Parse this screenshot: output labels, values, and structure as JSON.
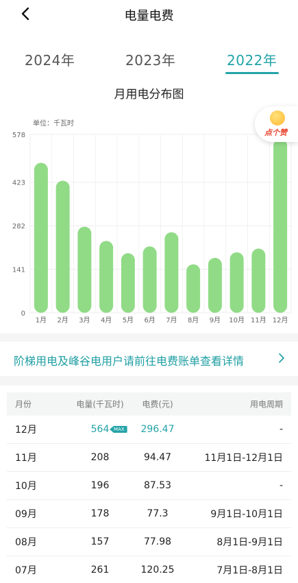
{
  "header": {
    "title": "电量电费"
  },
  "years": [
    {
      "label": "2024年",
      "active": false
    },
    {
      "label": "2023年",
      "active": false
    },
    {
      "label": "2022年",
      "active": true
    }
  ],
  "like_badge": {
    "label": "点个赞"
  },
  "chart_data": {
    "type": "bar",
    "title": "月用电分布图",
    "unit_label": "单位：千瓦时",
    "categories": [
      "1月",
      "2月",
      "3月",
      "4月",
      "5月",
      "6月",
      "7月",
      "8月",
      "9月",
      "10月",
      "11月",
      "12月"
    ],
    "values": [
      486,
      428,
      279,
      233,
      193,
      215,
      261,
      157,
      178,
      196,
      208,
      564
    ],
    "yticks": [
      0,
      141,
      282,
      423,
      578
    ],
    "ylim": [
      0,
      578
    ],
    "bar_color": "#91db87",
    "grid": true
  },
  "notice": {
    "text": "阶梯用电及峰谷电用户请前往电费账单查看详情"
  },
  "table": {
    "headers": {
      "month": "月份",
      "kwh": "电量(千瓦时)",
      "fee": "电费(元)",
      "period": "用电周期"
    },
    "max_label": "MAX",
    "rows": [
      {
        "month": "12月",
        "kwh": "564",
        "fee": "296.47",
        "period": "-",
        "max": true
      },
      {
        "month": "11月",
        "kwh": "208",
        "fee": "94.47",
        "period": "11月1日-12月1日",
        "max": false
      },
      {
        "month": "10月",
        "kwh": "196",
        "fee": "87.53",
        "period": "-",
        "max": false
      },
      {
        "month": "09月",
        "kwh": "178",
        "fee": "77.3",
        "period": "9月1日-10月1日",
        "max": false
      },
      {
        "month": "08月",
        "kwh": "157",
        "fee": "77.98",
        "period": "8月1日-9月1日",
        "max": false
      },
      {
        "month": "07月",
        "kwh": "261",
        "fee": "120.25",
        "period": "7月1日-8月1日",
        "max": false
      }
    ]
  },
  "colors": {
    "accent": "#23a3a8",
    "bar": "#91db87"
  }
}
